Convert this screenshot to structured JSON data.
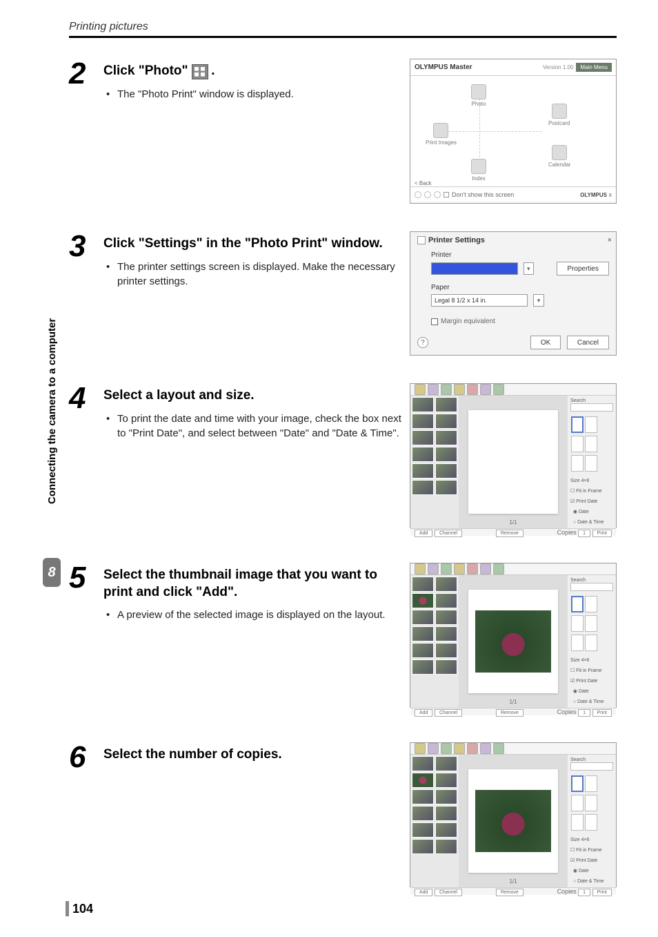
{
  "header": {
    "section_title": "Printing pictures"
  },
  "sidebar": {
    "chapter_label": "Connecting the camera to a computer",
    "chapter_number": "8"
  },
  "steps": {
    "s2": {
      "num": "2",
      "title_pre": "Click \"Photo\" ",
      "title_post": ".",
      "bullet": "The \"Photo Print\" window is displayed."
    },
    "s3": {
      "num": "3",
      "title": "Click \"Settings\" in the \"Photo Print\" window.",
      "bullet": "The printer settings screen is displayed. Make the necessary printer settings."
    },
    "s4": {
      "num": "4",
      "title": "Select a layout and size.",
      "bullet": "To print the date and time with your image, check the box next to \"Print Date\", and select between \"Date\" and \"Date & Time\"."
    },
    "s5": {
      "num": "5",
      "title": "Select the thumbnail image that you want to print and click \"Add\".",
      "bullet": "A preview of the selected image is displayed on the layout."
    },
    "s6": {
      "num": "6",
      "title": "Select the number of copies."
    }
  },
  "fig1": {
    "header_title": "OLYMPUS Master",
    "version": "Version 1.00",
    "main_menu": "Main Menu",
    "photo": "Photo",
    "print_images": "Print Images",
    "index": "Index",
    "postcard": "Postcard",
    "calendar": "Calendar",
    "back": "< Back",
    "dont_show": "Don't show this screen",
    "brand": "OLYMPUS",
    "brand_x": "x"
  },
  "fig2": {
    "title": "Printer Settings",
    "printer_label": "Printer",
    "properties": "Properties",
    "paper_label": "Paper",
    "paper_value": "Legal 8 1/2 x 14 in.",
    "margin": "Margin equivalent",
    "ok": "OK",
    "cancel": "Cancel",
    "help": "?",
    "close": "×",
    "dropdown_arrow": "▾"
  },
  "figapp": {
    "search_label": "Search",
    "size_label": "Size",
    "size_value": "4×6",
    "fit_frame": "Fit in Frame",
    "print_date": "Print Date",
    "date": "Date",
    "date_time": "Date & Time",
    "add": "Add",
    "remove": "Remove",
    "copies_label": "Copies",
    "copies_value": "1",
    "print": "Print",
    "page_indicator": "1/1",
    "channel": "Channel"
  },
  "page_number": "104"
}
